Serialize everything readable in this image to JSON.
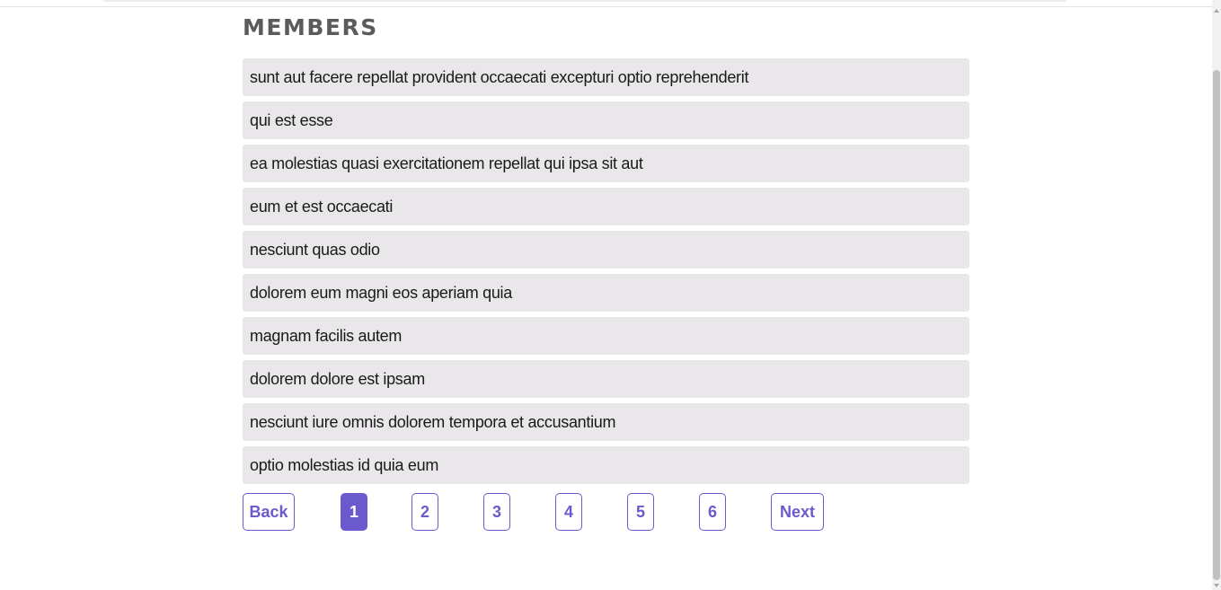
{
  "page": {
    "title": "MEMBERS"
  },
  "members": [
    "sunt aut facere repellat provident occaecati excepturi optio reprehenderit",
    "qui est esse",
    "ea molestias quasi exercitationem repellat qui ipsa sit aut",
    "eum et est occaecati",
    "nesciunt quas odio",
    "dolorem eum magni eos aperiam quia",
    "magnam facilis autem",
    "dolorem dolore est ipsam",
    "nesciunt iure omnis dolorem tempora et accusantium",
    "optio molestias id quia eum"
  ],
  "pagination": {
    "back_label": "Back",
    "next_label": "Next",
    "pages": [
      "1",
      "2",
      "3",
      "4",
      "5",
      "6"
    ],
    "current_page": "1"
  },
  "colors": {
    "accent": "#6a5acd",
    "title": "#5d5a5d",
    "item_background": "#e9e7e9"
  }
}
